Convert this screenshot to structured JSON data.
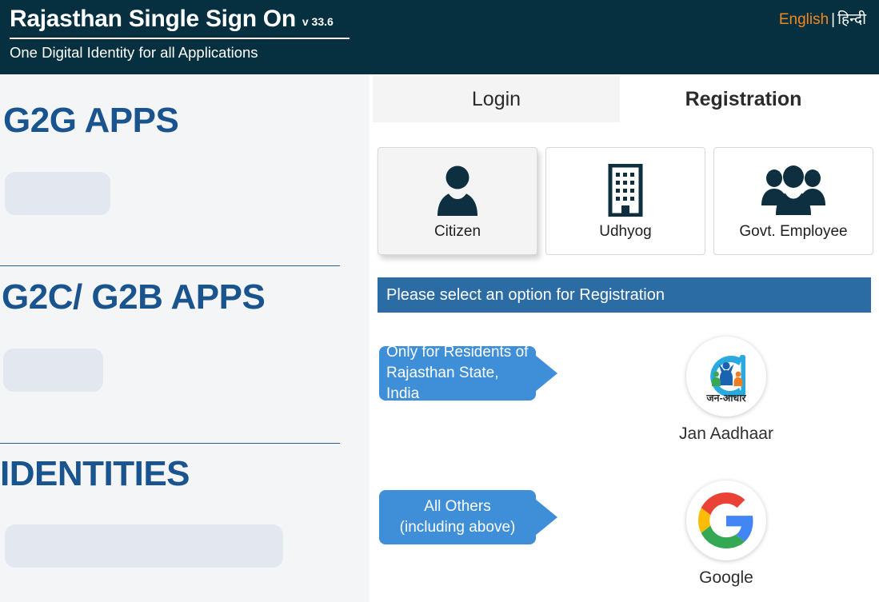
{
  "header": {
    "title": "Rajasthan Single Sign On",
    "version": "v 33.6",
    "subtitle": "One Digital Identity for all Applications",
    "language": {
      "english": "English",
      "separator": "|",
      "hindi": "हिन्दी",
      "active": "english"
    },
    "background_color": "#06303f",
    "accent_color": "#f0871f"
  },
  "sidebar": {
    "background_color": "#f4f5f6",
    "heading_color": "#19548f",
    "sections": [
      {
        "title": "G2G APPS",
        "placeholder_loading": true
      },
      {
        "title": "G2C/ G2B APPS",
        "placeholder_loading": true
      },
      {
        "title": "IDENTITIES",
        "placeholder_loading": true
      }
    ]
  },
  "main": {
    "tabs": [
      {
        "label": "Login",
        "active": false
      },
      {
        "label": "Registration",
        "active": true
      }
    ],
    "user_types": [
      {
        "label": "Citizen",
        "icon": "single-person-icon",
        "selected": true
      },
      {
        "label": "Udhyog",
        "icon": "building-icon",
        "selected": false
      },
      {
        "label": "Govt. Employee",
        "icon": "people-group-icon",
        "selected": false
      }
    ],
    "banner": {
      "text": "Please select an option for Registration",
      "color": "#2c6ca5"
    },
    "registration_options": [
      {
        "callout_lines": [
          "Only for Residents of",
          "Rajasthan State, India"
        ],
        "callout_align": "left",
        "logo": "jan-aadhaar-logo",
        "logo_text": "जन-आधार",
        "caption": "Jan Aadhaar",
        "callout_color": "#3e8ed8"
      },
      {
        "callout_lines": [
          "All Others",
          "(including above)"
        ],
        "callout_align": "center",
        "logo": "google-logo",
        "caption": "Google",
        "callout_color": "#3e8ed8"
      }
    ]
  }
}
